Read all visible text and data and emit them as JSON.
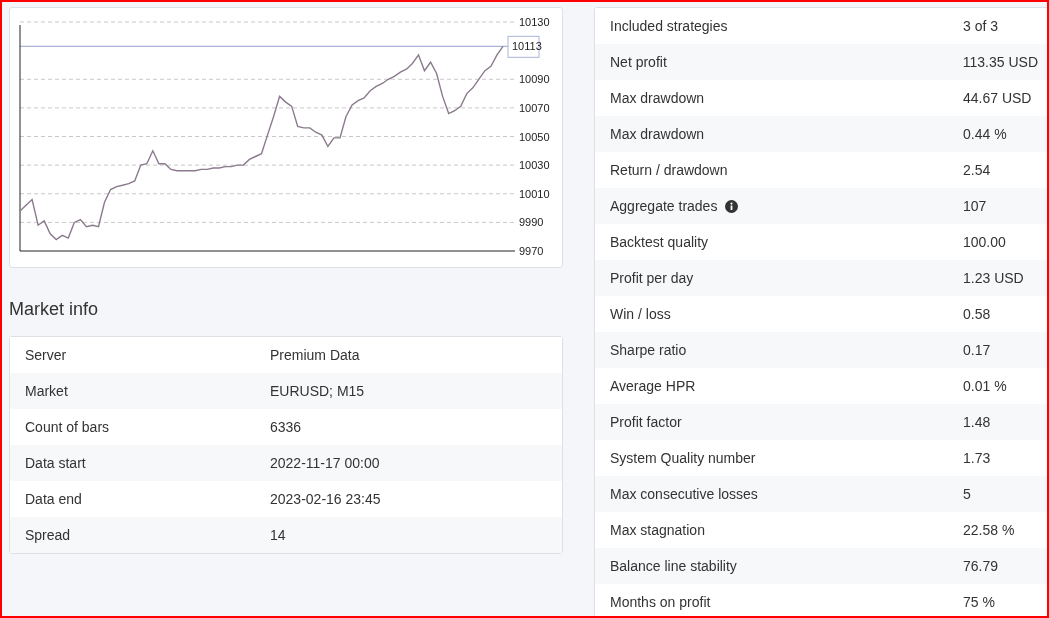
{
  "balance_chart": {
    "chart_data": {
      "type": "line",
      "grid": true,
      "series": [
        {
          "color": "#8a7a8c",
          "values": [
            9998,
            10002,
            10006,
            9988,
            9991,
            9982,
            9978,
            9981,
            9979,
            9990,
            9992,
            9987,
            9988,
            9987,
            10004,
            10013,
            10015,
            10016,
            10017,
            10019,
            10030,
            10031,
            10040,
            10031,
            10031,
            10027,
            10026,
            10026,
            10026,
            10026,
            10027,
            10027,
            10028,
            10028,
            10029,
            10029,
            10030,
            10030,
            10034,
            10036,
            10038,
            10051,
            10064,
            10078,
            10074,
            10071,
            10057,
            10056,
            10056,
            10053,
            10051,
            10043,
            10049,
            10049,
            10064,
            10072,
            10075,
            10077,
            10082,
            10085,
            10087,
            10090,
            10092,
            10095,
            10097,
            10101,
            10107,
            10096,
            10102,
            10094,
            10078,
            10066,
            10068,
            10071,
            10080,
            10084,
            10090,
            10096,
            10099,
            10107,
            10113
          ]
        }
      ],
      "ylim": [
        9970,
        10130
      ],
      "yticks": [
        9970,
        9990,
        10010,
        10030,
        10050,
        10070,
        10090,
        10130
      ],
      "ref_lines": [
        {
          "axis": "y",
          "value": 10113,
          "label": "10113",
          "color": "#a9b4d8"
        }
      ]
    }
  },
  "market_info": {
    "title": "Market info",
    "rows": [
      {
        "label": "Server",
        "value": "Premium Data"
      },
      {
        "label": "Market",
        "value": "EURUSD; M15"
      },
      {
        "label": "Count of bars",
        "value": "6336"
      },
      {
        "label": "Data start",
        "value": "2022-11-17 00:00"
      },
      {
        "label": "Data end",
        "value": "2023-02-16 23:45"
      },
      {
        "label": "Spread",
        "value": "14"
      }
    ]
  },
  "statistics": {
    "rows": [
      {
        "label": "Included strategies",
        "value": "3 of 3",
        "info": false
      },
      {
        "label": "Net profit",
        "value": "113.35 USD",
        "info": false
      },
      {
        "label": "Max drawdown",
        "value": "44.67 USD",
        "info": false
      },
      {
        "label": "Max drawdown",
        "value": "0.44 %",
        "info": false
      },
      {
        "label": "Return / drawdown",
        "value": "2.54",
        "info": false
      },
      {
        "label": "Aggregate trades",
        "value": "107",
        "info": true
      },
      {
        "label": "Backtest quality",
        "value": "100.00",
        "info": false
      },
      {
        "label": "Profit per day",
        "value": "1.23 USD",
        "info": false
      },
      {
        "label": "Win / loss",
        "value": "0.58",
        "info": false
      },
      {
        "label": "Sharpe ratio",
        "value": "0.17",
        "info": false
      },
      {
        "label": "Average HPR",
        "value": "0.01 %",
        "info": false
      },
      {
        "label": "Profit factor",
        "value": "1.48",
        "info": false
      },
      {
        "label": "System Quality number",
        "value": "1.73",
        "info": false
      },
      {
        "label": "Max consecutive losses",
        "value": "5",
        "info": false
      },
      {
        "label": "Max stagnation",
        "value": "22.58 %",
        "info": false
      },
      {
        "label": "Balance line stability",
        "value": "76.79",
        "info": false
      },
      {
        "label": "Months on profit",
        "value": "75 %",
        "info": false
      }
    ]
  }
}
